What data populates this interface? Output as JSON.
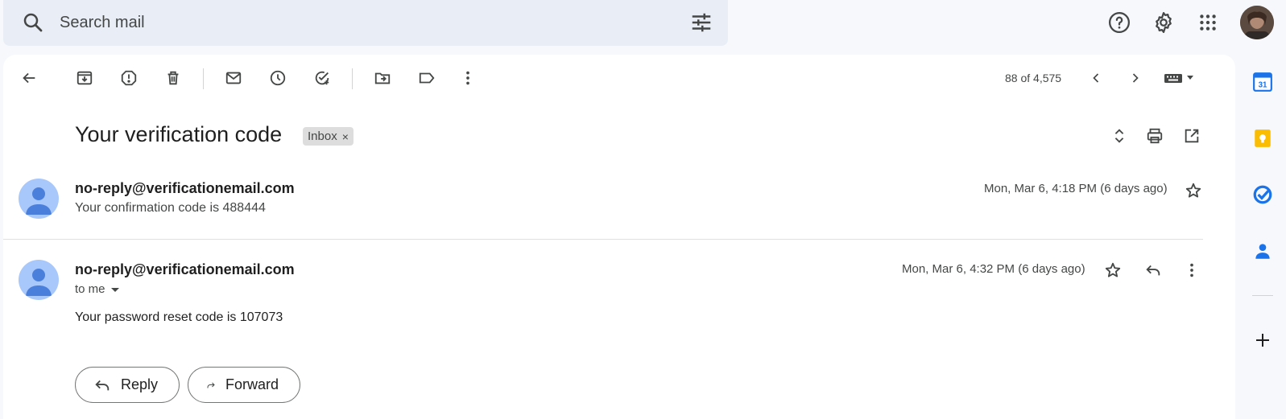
{
  "search": {
    "placeholder": "Search mail"
  },
  "toolbar": {
    "page_count": "88 of 4,575"
  },
  "thread": {
    "subject": "Your verification code",
    "label": "Inbox",
    "label_remove": "×"
  },
  "messages": [
    {
      "sender": "no-reply@verificationemail.com",
      "snippet": "Your confirmation code is 488444",
      "date": "Mon, Mar 6, 4:18 PM (6 days ago)"
    },
    {
      "sender": "no-reply@verificationemail.com",
      "recipient": "to me",
      "date": "Mon, Mar 6, 4:32 PM (6 days ago)",
      "body": "Your password reset code is 107073"
    }
  ],
  "actions": {
    "reply": "Reply",
    "forward": "Forward"
  },
  "colors": {
    "background": "#f6f8fc",
    "search_bg": "#e9eef6",
    "avatar_bg": "#a8c7fa",
    "avatar_fg": "#4a7fdc",
    "calendar_blue": "#1a73e8",
    "keep_yellow": "#fbbc04",
    "tasks_blue": "#1a73e8",
    "contacts_blue": "#1a73e8"
  }
}
